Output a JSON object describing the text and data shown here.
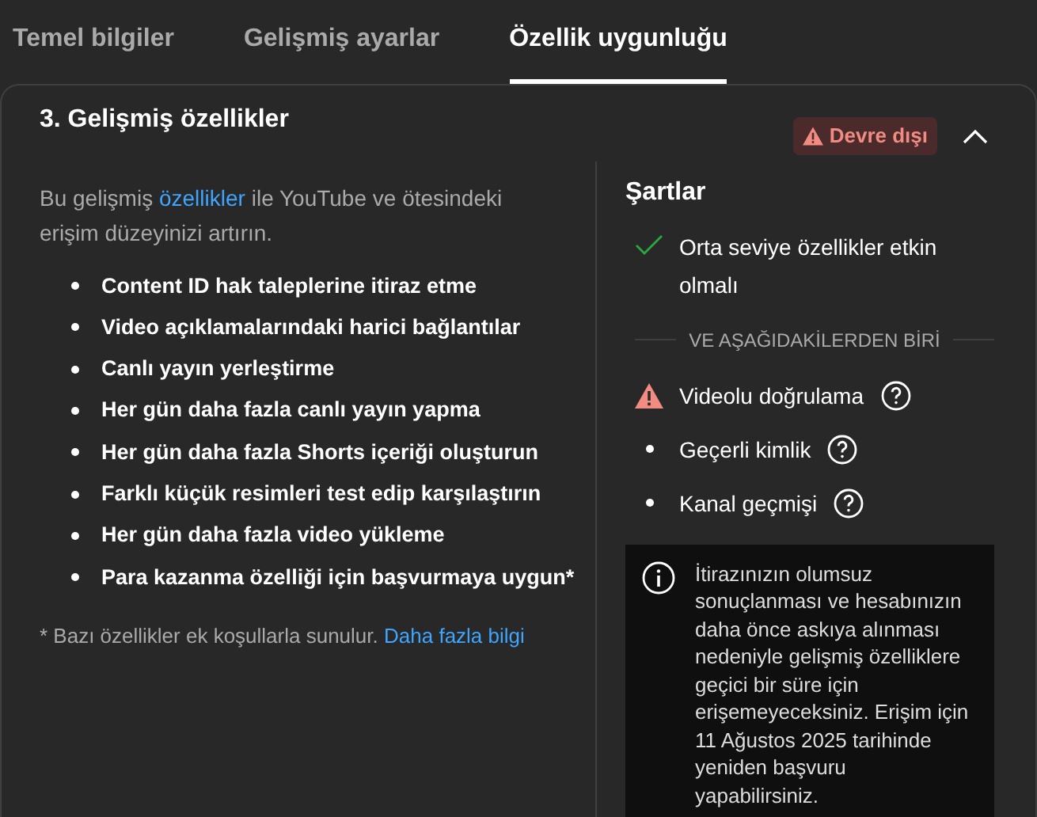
{
  "tabs": [
    {
      "label": "Temel bilgiler",
      "selected": false
    },
    {
      "label": "Gelişmiş ayarlar",
      "selected": false
    },
    {
      "label": "Özellik uygunluğu",
      "selected": true
    }
  ],
  "section": {
    "title": "3. Gelişmiş özellikler",
    "status": "Devre dışı",
    "expanded": true,
    "intro": {
      "before": "Bu gelişmiş",
      "link": "özellikler",
      "after": "ile YouTube ve ötesindeki erişim düzeyinizi artırın."
    },
    "features": [
      "Content ID hak taleplerine itiraz etme",
      "Video açıklamalarındaki harici bağlantılar",
      "Canlı yayın yerleştirme",
      "Her gün daha fazla canlı yayın yapma",
      "Her gün daha fazla Shorts içeriği oluşturun",
      "Farklı küçük resimleri test edip karşılaştırın",
      "Her gün daha fazla video yükleme",
      "Para kazanma özelliği için başvurmaya uygun*"
    ],
    "footnote": {
      "text": "* Bazı özellikler ek koşullarla sunulur.",
      "link": "Daha fazla bilgi"
    },
    "requirements": {
      "title": "Şartlar",
      "items": [
        {
          "kind": "met",
          "label": "Orta seviye özellikler etkin olmalı",
          "help": false
        },
        {
          "kind": "divider",
          "label": "VE AŞAĞIDAKİLERDEN BİRİ"
        },
        {
          "kind": "failed",
          "label": "Videolu doğrulama",
          "help": true
        },
        {
          "kind": "bullet",
          "label": "Geçerli kimlik",
          "help": true
        },
        {
          "kind": "bullet",
          "label": "Kanal geçmişi",
          "help": true
        }
      ],
      "notice": "İtirazınızın olumsuz sonuçlanması ve hesabınızın daha önce askıya alınması nedeniyle gelişmiş özelliklere geçici bir süre için erişemeyeceksiniz. Erişim için 11 Ağustos 2025 tarihinde yeniden başvuru yapabilirsiniz."
    }
  }
}
